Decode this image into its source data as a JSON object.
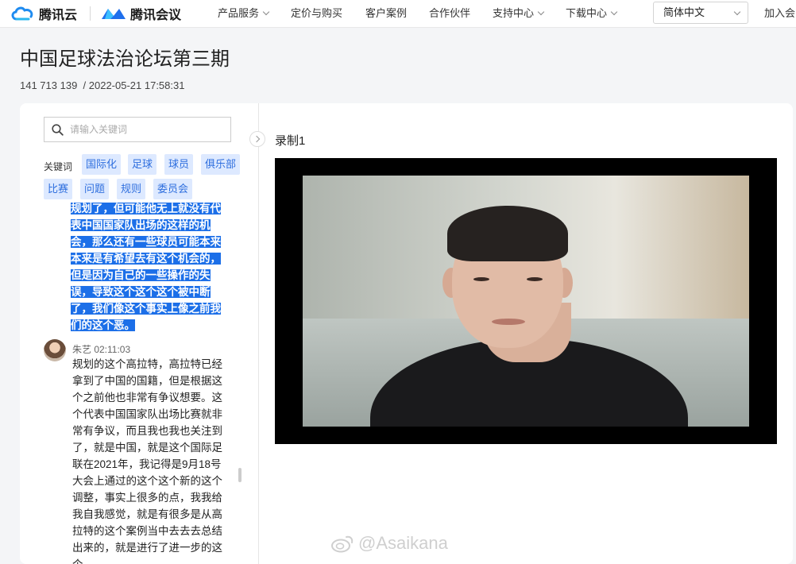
{
  "header": {
    "logo_primary": "腾讯云",
    "logo_secondary": "腾讯会议",
    "nav": [
      "产品服务",
      "定价与购买",
      "客户案例",
      "合作伙伴",
      "支持中心",
      "下载中心"
    ],
    "language": "简体中文",
    "join_label": "加入会"
  },
  "page": {
    "title": "中国足球法治论坛第三期",
    "meeting_id": "141 713 139",
    "datetime": "/ 2022-05-21 17:58:31"
  },
  "sidebar": {
    "search_placeholder": "请输入关键词",
    "keywords_label": "关键词",
    "keywords": [
      "国际化",
      "足球",
      "球员",
      "俱乐部",
      "比赛",
      "问题",
      "规则",
      "委员会"
    ]
  },
  "transcript": {
    "highlighted_lines": [
      "规划了，但可能他无上就没有代",
      "表中国国家队出场的这样的机",
      "会，那么还有一些球员可能本来",
      "本来是有希望去有这个机会的，",
      "但是因为自己的一些操作的失",
      "误，导致这个这个这个被中断",
      "了，我们像这个事实上像之前我",
      "们的这个恶。"
    ],
    "speaker_name": "朱艺 02:11:03",
    "speaker_text": "规划的这个高拉特，高拉特已经拿到了中国的国籍，但是根据这个之前他也非常有争议想要。这个代表中国国家队出场比赛就非常有争议，而且我也我也关注到了，就是中国，就是这个国际足联在2021年，我记得是9月18号大会上通过的这个这个新的这个调整，事实上很多的点，我我给我自我感觉，就是有很多是从高拉特的这个案例当中去去去总结出来的，就是进行了进一步的这个"
  },
  "recording": {
    "label": "录制1"
  },
  "watermark": {
    "text": "@Asaikana"
  },
  "colors": {
    "brand_blue": "#1c6fe8",
    "tag_bg": "#dde9ff",
    "tag_text": "#2f6fde"
  },
  "icons": [
    "tencent-cloud-icon",
    "tencent-meeting-icon",
    "chevron-down-icon",
    "search-icon",
    "chevron-right-icon",
    "weibo-icon"
  ]
}
